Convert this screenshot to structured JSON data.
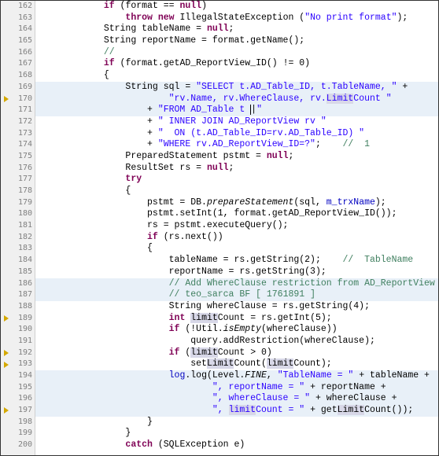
{
  "start": 162,
  "lines": [
    {
      "n": 162,
      "seg": [
        [
          "            ",
          ""
        ],
        [
          "if",
          "k"
        ],
        [
          " (format == ",
          ""
        ],
        [
          "null",
          "k"
        ],
        [
          ")",
          ""
        ]
      ]
    },
    {
      "n": 163,
      "seg": [
        [
          "                ",
          ""
        ],
        [
          "throw new",
          "k"
        ],
        [
          " IllegalStateException (",
          ""
        ],
        [
          "\"No print format\"",
          "s"
        ],
        [
          ");",
          ""
        ]
      ]
    },
    {
      "n": 164,
      "seg": [
        [
          "            String tableName = ",
          ""
        ],
        [
          "null",
          "k"
        ],
        [
          ";",
          ""
        ]
      ]
    },
    {
      "n": 165,
      "seg": [
        [
          "            String reportName = format.getName();",
          ""
        ]
      ]
    },
    {
      "n": 166,
      "seg": [
        [
          "            ",
          ""
        ],
        [
          "//",
          "c"
        ]
      ]
    },
    {
      "n": 167,
      "seg": [
        [
          "            ",
          ""
        ],
        [
          "if",
          "k"
        ],
        [
          " (format.getAD_ReportView_ID() != 0)",
          ""
        ]
      ]
    },
    {
      "n": 168,
      "seg": [
        [
          "            {",
          ""
        ]
      ]
    },
    {
      "n": 169,
      "hl": true,
      "seg": [
        [
          "                String sql = ",
          ""
        ],
        [
          "\"SELECT t.AD_Table_ID, t.TableName, \"",
          "s"
        ],
        [
          " +",
          ""
        ]
      ]
    },
    {
      "n": 170,
      "hl": true,
      "marker": "arrow",
      "seg": [
        [
          "                        ",
          ""
        ],
        [
          "\"rv.Name, rv.WhereClause, rv.",
          "s"
        ],
        [
          "Limit",
          "s sel"
        ],
        [
          "Count \"",
          "s"
        ]
      ]
    },
    {
      "n": 171,
      "hl": true,
      "seg": [
        [
          "                    + ",
          ""
        ],
        [
          "\"FROM AD_Table t ",
          "s"
        ],
        [
          "|",
          "cursor"
        ],
        [
          "\"",
          "s"
        ]
      ]
    },
    {
      "n": 172,
      "seg": [
        [
          "                    + ",
          ""
        ],
        [
          "\" INNER JOIN AD_ReportView rv \"",
          "s"
        ]
      ]
    },
    {
      "n": 173,
      "seg": [
        [
          "                    + ",
          ""
        ],
        [
          "\"  ON (t.AD_Table_ID=rv.AD_Table_ID) \"",
          "s"
        ]
      ]
    },
    {
      "n": 174,
      "seg": [
        [
          "                    + ",
          ""
        ],
        [
          "\"WHERE rv.AD_ReportView_ID=?\"",
          "s"
        ],
        [
          ";    ",
          ""
        ],
        [
          "//  1",
          "c"
        ]
      ]
    },
    {
      "n": 175,
      "seg": [
        [
          "                PreparedStatement pstmt = ",
          ""
        ],
        [
          "null",
          "k"
        ],
        [
          ";",
          ""
        ]
      ]
    },
    {
      "n": 176,
      "seg": [
        [
          "                ResultSet rs = ",
          ""
        ],
        [
          "null",
          "k"
        ],
        [
          ";",
          ""
        ]
      ]
    },
    {
      "n": 177,
      "seg": [
        [
          "                ",
          ""
        ],
        [
          "try",
          "k"
        ]
      ]
    },
    {
      "n": 178,
      "seg": [
        [
          "                {",
          ""
        ]
      ]
    },
    {
      "n": 179,
      "seg": [
        [
          "                    pstmt = DB.",
          ""
        ],
        [
          "prepareStatement",
          "m"
        ],
        [
          "(sql, ",
          ""
        ],
        [
          "m_trxName",
          "f"
        ],
        [
          ");",
          ""
        ]
      ]
    },
    {
      "n": 180,
      "seg": [
        [
          "                    pstmt.setInt(1, format.getAD_ReportView_ID());",
          ""
        ]
      ]
    },
    {
      "n": 181,
      "seg": [
        [
          "                    rs = pstmt.executeQuery();",
          ""
        ]
      ]
    },
    {
      "n": 182,
      "seg": [
        [
          "                    ",
          ""
        ],
        [
          "if",
          "k"
        ],
        [
          " (rs.next())",
          ""
        ]
      ]
    },
    {
      "n": 183,
      "seg": [
        [
          "                    {",
          ""
        ]
      ]
    },
    {
      "n": 184,
      "seg": [
        [
          "                        tableName = rs.getString(2);    ",
          ""
        ],
        [
          "//  TableName",
          "c"
        ]
      ]
    },
    {
      "n": 185,
      "seg": [
        [
          "                        reportName = rs.getString(3);",
          ""
        ]
      ]
    },
    {
      "n": 186,
      "hl": true,
      "seg": [
        [
          "                        ",
          ""
        ],
        [
          "// Add WhereClause restriction from AD_ReportView",
          "c"
        ]
      ]
    },
    {
      "n": 187,
      "hl": true,
      "seg": [
        [
          "                        ",
          ""
        ],
        [
          "// teo_sarca BF [ 1761891 ]",
          "c"
        ]
      ]
    },
    {
      "n": 188,
      "seg": [
        [
          "                        String whereClause = rs.getString(4);",
          ""
        ]
      ]
    },
    {
      "n": 189,
      "marker": "arrow",
      "seg": [
        [
          "                        ",
          ""
        ],
        [
          "int",
          "k"
        ],
        [
          " ",
          ""
        ],
        [
          "limit",
          "sel"
        ],
        [
          "Count = rs.getInt(5);",
          ""
        ]
      ]
    },
    {
      "n": 190,
      "seg": [
        [
          "                        ",
          ""
        ],
        [
          "if",
          "k"
        ],
        [
          " (!Util.",
          ""
        ],
        [
          "isEmpty",
          "m"
        ],
        [
          "(whereClause))",
          ""
        ]
      ]
    },
    {
      "n": 191,
      "seg": [
        [
          "                            query.addRestriction(whereClause);",
          ""
        ]
      ]
    },
    {
      "n": 192,
      "marker": "arrow",
      "seg": [
        [
          "                        ",
          ""
        ],
        [
          "if",
          "k"
        ],
        [
          " (",
          ""
        ],
        [
          "limit",
          "sel"
        ],
        [
          "Count > 0)",
          ""
        ]
      ]
    },
    {
      "n": 193,
      "marker": "arrow",
      "seg": [
        [
          "                            set",
          ""
        ],
        [
          "Limit",
          "sel"
        ],
        [
          "Count(",
          ""
        ],
        [
          "limit",
          "sel"
        ],
        [
          "Count);",
          ""
        ]
      ]
    },
    {
      "n": 194,
      "hl": true,
      "seg": [
        [
          "                        ",
          ""
        ],
        [
          "log",
          "f"
        ],
        [
          ".log(Level.",
          ""
        ],
        [
          "FINE",
          "m"
        ],
        [
          ", ",
          ""
        ],
        [
          "\"TableName = \"",
          "s"
        ],
        [
          " + tableName +",
          ""
        ]
      ]
    },
    {
      "n": 195,
      "hl": true,
      "seg": [
        [
          "                                ",
          ""
        ],
        [
          "\", reportName = \"",
          "s"
        ],
        [
          " + reportName +",
          ""
        ]
      ]
    },
    {
      "n": 196,
      "hl": true,
      "seg": [
        [
          "                                ",
          ""
        ],
        [
          "\", whereClause = \"",
          "s"
        ],
        [
          " + whereClause +",
          ""
        ]
      ]
    },
    {
      "n": 197,
      "hl": true,
      "marker": "arrow",
      "seg": [
        [
          "                                ",
          ""
        ],
        [
          "\", ",
          "s"
        ],
        [
          "limit",
          "s sel"
        ],
        [
          "Count = \"",
          "s"
        ],
        [
          " + get",
          ""
        ],
        [
          "Limit",
          "sel"
        ],
        [
          "Count());",
          ""
        ]
      ]
    },
    {
      "n": 198,
      "seg": [
        [
          "                    }",
          ""
        ]
      ]
    },
    {
      "n": 199,
      "seg": [
        [
          "                }",
          ""
        ]
      ]
    },
    {
      "n": 200,
      "seg": [
        [
          "                ",
          ""
        ],
        [
          "catch",
          "k"
        ],
        [
          " (SQLException e)",
          ""
        ]
      ]
    }
  ]
}
